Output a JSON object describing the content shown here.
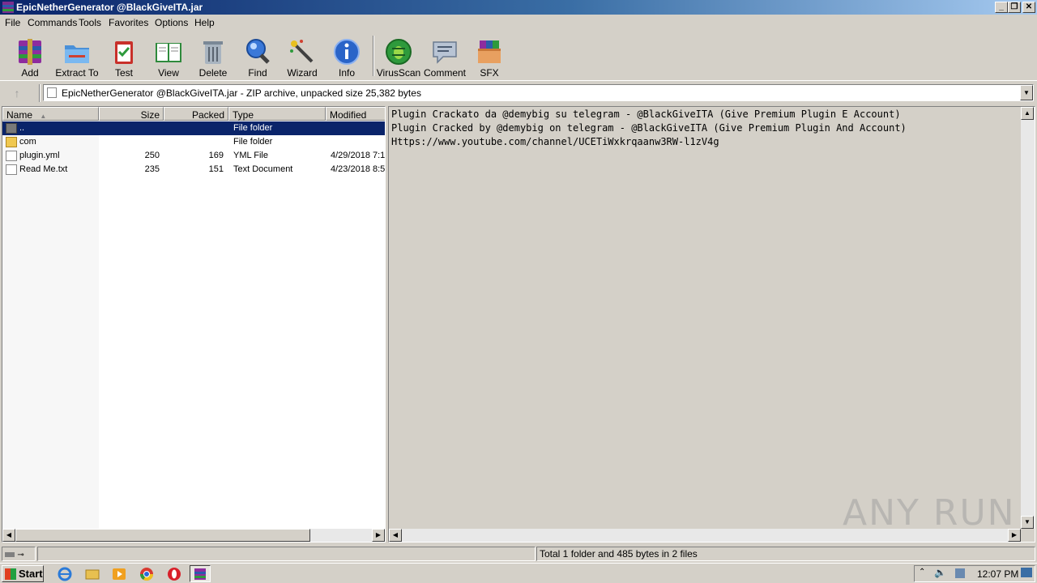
{
  "window": {
    "title": "EpicNetherGenerator @BlackGiveITA.jar"
  },
  "menu": [
    "File",
    "Commands",
    "Tools",
    "Favorites",
    "Options",
    "Help"
  ],
  "toolbar": [
    {
      "label": "Add",
      "icon": "add-archive-icon"
    },
    {
      "label": "Extract To",
      "icon": "extract-folder-icon"
    },
    {
      "label": "Test",
      "icon": "test-clipboard-icon"
    },
    {
      "label": "View",
      "icon": "view-book-icon"
    },
    {
      "label": "Delete",
      "icon": "trash-icon"
    },
    {
      "label": "Find",
      "icon": "magnifier-icon"
    },
    {
      "label": "Wizard",
      "icon": "wand-icon"
    },
    {
      "label": "Info",
      "icon": "info-icon"
    },
    {
      "label": "VirusScan",
      "icon": "bug-icon"
    },
    {
      "label": "Comment",
      "icon": "comment-icon"
    },
    {
      "label": "SFX",
      "icon": "sfx-box-icon"
    }
  ],
  "address": {
    "text": "EpicNetherGenerator @BlackGiveITA.jar - ZIP archive, unpacked size 25,382 bytes"
  },
  "columns": [
    "Name",
    "Size",
    "Packed",
    "Type",
    "Modified"
  ],
  "files": [
    {
      "name": "..",
      "size": "",
      "packed": "",
      "type": "File folder",
      "modified": "",
      "kind": "up"
    },
    {
      "name": "com",
      "size": "",
      "packed": "",
      "type": "File folder",
      "modified": "",
      "kind": "folder"
    },
    {
      "name": "plugin.yml",
      "size": "250",
      "packed": "169",
      "type": "YML File",
      "modified": "4/29/2018 7:1",
      "kind": "file"
    },
    {
      "name": "Read Me.txt",
      "size": "235",
      "packed": "151",
      "type": "Text Document",
      "modified": "4/23/2018 8:5",
      "kind": "file"
    }
  ],
  "preview": {
    "lines": [
      "Plugin Crackato da @demybig su telegram - @BlackGiveITA (Give Premium Plugin E Account)",
      "Plugin Cracked by @demybig on telegram - @BlackGiveITA (Give Premium Plugin And Account)",
      "Https://www.youtube.com/channel/UCETiWxkrqaanw3RW-l1zV4g"
    ]
  },
  "status": {
    "summary": "Total 1 folder and 485 bytes in 2 files"
  },
  "watermark": "ANY RUN",
  "taskbar": {
    "start_label": "Start",
    "clock": "12:07 PM"
  }
}
